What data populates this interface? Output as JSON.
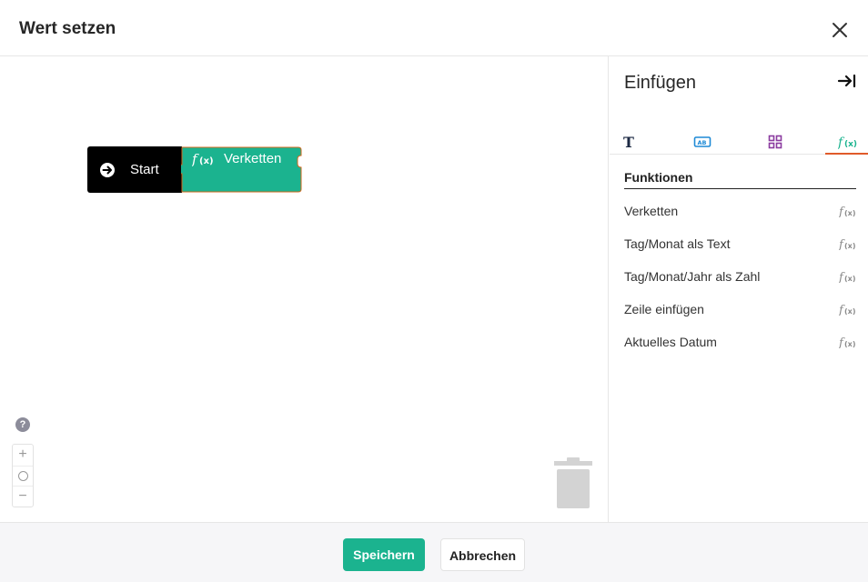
{
  "dialog": {
    "title": "Wert setzen"
  },
  "canvas": {
    "start_block": {
      "label": "Start"
    },
    "function_block": {
      "label": "Verketten",
      "color": "#1bb38f"
    },
    "help_label": "?",
    "zoom": {
      "in": "+",
      "out": "−"
    }
  },
  "sidebar": {
    "title": "Einfügen",
    "tabs": [
      {
        "icon": "text-icon"
      },
      {
        "icon": "ab-field-icon"
      },
      {
        "icon": "grid-icon"
      },
      {
        "icon": "function-icon",
        "active": true
      }
    ],
    "section_title": "Funktionen",
    "functions": [
      {
        "label": "Verketten"
      },
      {
        "label": "Tag/Monat als Text"
      },
      {
        "label": "Tag/Monat/Jahr als Zahl"
      },
      {
        "label": "Zeile einfügen"
      },
      {
        "label": "Aktuelles Datum"
      }
    ]
  },
  "footer": {
    "save_label": "Speichern",
    "cancel_label": "Abbrechen"
  },
  "colors": {
    "accent": "#1bb38f",
    "tab_active": "#e05a2a",
    "block_start": "#000000"
  }
}
